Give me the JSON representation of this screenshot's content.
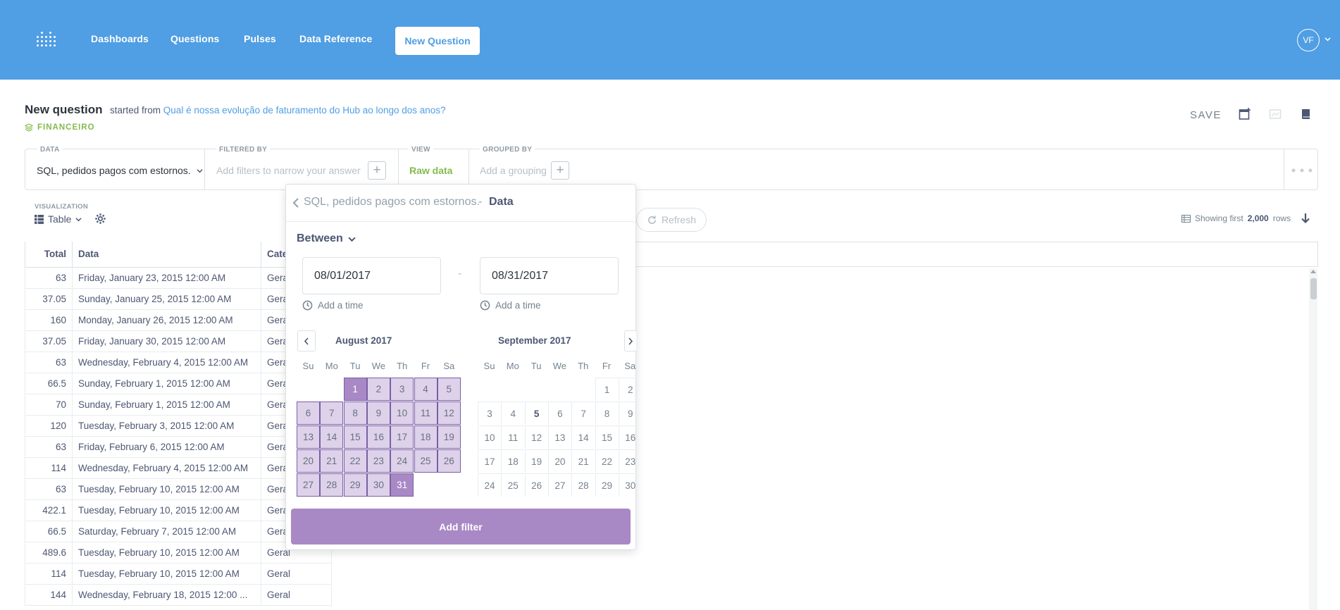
{
  "nav": {
    "links": [
      "Dashboards",
      "Questions",
      "Pulses",
      "Data Reference"
    ],
    "new_question": "New Question",
    "avatar": "VF",
    "bg_color": "#509ee3"
  },
  "header": {
    "title": "New question",
    "started_prefix": "started from",
    "started_link": "Qual é nossa evolução de faturamento do Hub ao longo dos anos?",
    "collection": "FINANCEIRO",
    "save": "SAVE"
  },
  "query_builder": {
    "data_label": "DATA",
    "data_value": "SQL, pedidos pagos com estornos.",
    "filtered_label": "FILTERED BY",
    "filter_placeholder": "Add filters to narrow your answer",
    "view_label": "VIEW",
    "view_value": "Raw data",
    "grouped_label": "GROUPED BY",
    "group_placeholder": "Add a grouping"
  },
  "visualization": {
    "label": "VISUALIZATION",
    "type": "Table",
    "refresh": "Refresh",
    "rows_prefix": "Showing first",
    "rows_count": "2,000",
    "rows_suffix": "rows"
  },
  "table": {
    "columns": [
      "Total",
      "Data",
      "Cate"
    ],
    "rows": [
      [
        "63",
        "Friday, January 23, 2015 12:00 AM",
        "Gera"
      ],
      [
        "37.05",
        "Sunday, January 25, 2015 12:00 AM",
        "Gera"
      ],
      [
        "160",
        "Monday, January 26, 2015 12:00 AM",
        "Gera"
      ],
      [
        "37.05",
        "Friday, January 30, 2015 12:00 AM",
        "Gera"
      ],
      [
        "63",
        "Wednesday, February 4, 2015 12:00 AM",
        "Gera"
      ],
      [
        "66.5",
        "Sunday, February 1, 2015 12:00 AM",
        "Gera"
      ],
      [
        "70",
        "Sunday, February 1, 2015 12:00 AM",
        "Gera"
      ],
      [
        "120",
        "Tuesday, February 3, 2015 12:00 AM",
        "Gera"
      ],
      [
        "63",
        "Friday, February 6, 2015 12:00 AM",
        "Gera"
      ],
      [
        "114",
        "Wednesday, February 4, 2015 12:00 AM",
        "Gera"
      ],
      [
        "63",
        "Tuesday, February 10, 2015 12:00 AM",
        "Gera"
      ],
      [
        "422.1",
        "Tuesday, February 10, 2015 12:00 AM",
        "Gera"
      ],
      [
        "66.5",
        "Saturday, February 7, 2015 12:00 AM",
        "Gera"
      ],
      [
        "489.6",
        "Tuesday, February 10, 2015 12:00 AM",
        "Geral"
      ],
      [
        "114",
        "Tuesday, February 10, 2015 12:00 AM",
        "Geral"
      ],
      [
        "144",
        "Wednesday, February 18, 2015 12:00 ...",
        "Geral"
      ]
    ]
  },
  "popover": {
    "back_source": "SQL, pedidos pagos com estornos.",
    "separator": "-",
    "field": "Data",
    "operator": "Between",
    "start_date": "08/01/2017",
    "end_date": "08/31/2017",
    "range_dash": "-",
    "add_time": "Add a time",
    "add_filter": "Add filter",
    "accent_color": "#a989c5",
    "weekdays": [
      "Su",
      "Mo",
      "Tu",
      "We",
      "Th",
      "Fr",
      "Sa"
    ],
    "months": [
      {
        "title": "August 2017",
        "first_weekday": 2,
        "days": 31
      },
      {
        "title": "September 2017",
        "first_weekday": 5,
        "days": 30
      }
    ],
    "today": "5"
  }
}
